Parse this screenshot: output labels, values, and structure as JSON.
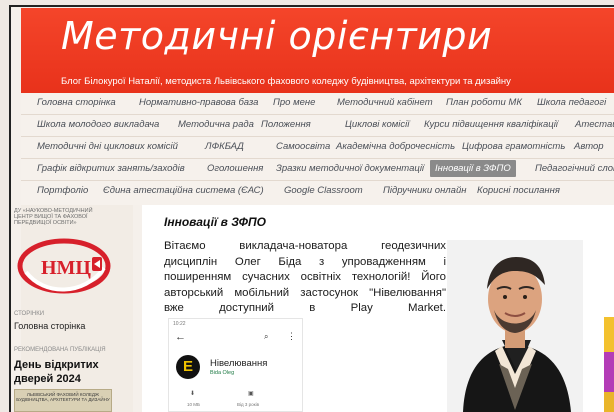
{
  "header": {
    "title": "Методичні орієнтири",
    "subtitle": "Блог Білокурої Наталії, методиста Львівського фахового коледжу будівництва, архітектури та дизайну"
  },
  "nav": {
    "rows": [
      [
        "Головна сторінка",
        "Нормативно-правова база",
        "Про мене",
        "Методичний кабінет",
        "План роботи МК",
        "Школа педагогі"
      ],
      [
        "Школа молодого викладача",
        "Методична рада",
        "Положення",
        "Циклові комісії",
        "Курси підвищення кваліфікації",
        "Атестац"
      ],
      [
        "Методичні дні циклових комісій",
        "ЛФКБАД",
        "Самоосвіта",
        "Академічна доброчесність",
        "Цифрова грамотність",
        "Автор"
      ],
      [
        "Графік відкритих занять/заходів",
        "Оголошення",
        "Зразки методичної документації",
        "Інновації в ЗФПО",
        "Педагогічний слов"
      ],
      [
        "Портфоліо",
        "Єдина атестаційна система (ЄАС)",
        "Google Classroom",
        "Підручники онлайн",
        "Корисні посилання"
      ]
    ],
    "active": "Інновації в ЗФПО"
  },
  "sidebar": {
    "org_text": "ДУ «НАУКОВО-МЕТОДИЧНИЙ ЦЕНТР ВИЩОЇ ТА ФАХОВОЇ ПЕРЕДВИЩОЇ ОСВІТИ»",
    "logo_text": "НМЦ",
    "pages_heading": "СТОРІНКИ",
    "home_link": "Головна сторінка",
    "featured_heading": "РЕКОМЕНДОВАНА ПУБЛІКАЦІЯ",
    "featured_title": "День відкритих дверей 2024",
    "featured_thumb_text": "ЛЬВІВСЬКИЙ ФАХОВИЙ КОЛЕДЖ БУДІВНИЦТВА, АРХІТЕКТУРИ ТА ДИЗАЙНУ"
  },
  "post": {
    "title": "Інновації в ЗФПО",
    "lines": [
      "Вітаємо викладача-новатора геодезичних",
      "дисциплін Олег Біда з упровадженням і",
      "поширенням сучасних освітніх технологій! Його",
      "авторський мобільний застосунок \"Нівелювання\"",
      "вже доступний в Play Market."
    ]
  },
  "phone": {
    "status": "10:22",
    "app_name": "Нівелювання",
    "developer": "Bida Oleg",
    "stat_1": "10 МБ",
    "stat_2": "Від 3 років"
  },
  "colors": {
    "header_red": "#e8321b",
    "active_tab": "#8a8a8a",
    "logo_red": "#d7202b"
  }
}
